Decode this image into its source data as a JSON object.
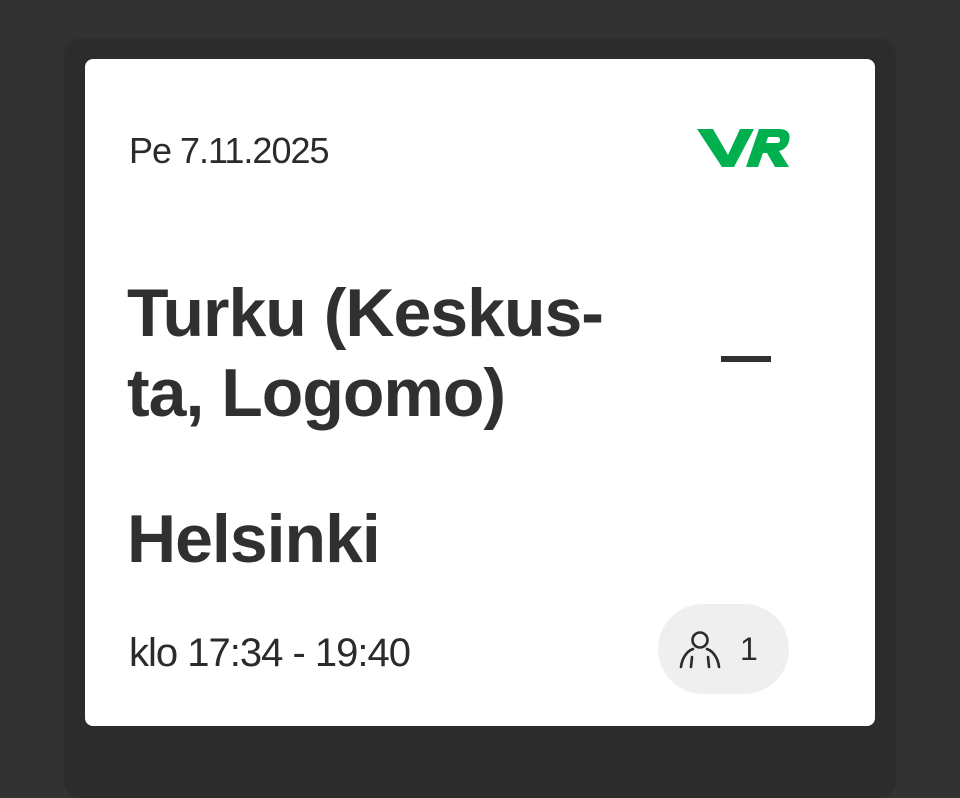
{
  "ticket": {
    "date": "Pe 7.11.2025",
    "origin": "Turku (Keskus-ta, Logomo)",
    "origin_line1": "Turku (Keskus-",
    "origin_line2": "ta, Logomo)",
    "destination": "Helsinki",
    "time": "klo 17:34 - 19:40",
    "passenger_count": "1"
  },
  "brand": {
    "logo_text": "VR",
    "color": "#00b04f"
  },
  "icons": {
    "logo": "vr-logo",
    "passenger": "person-icon"
  }
}
